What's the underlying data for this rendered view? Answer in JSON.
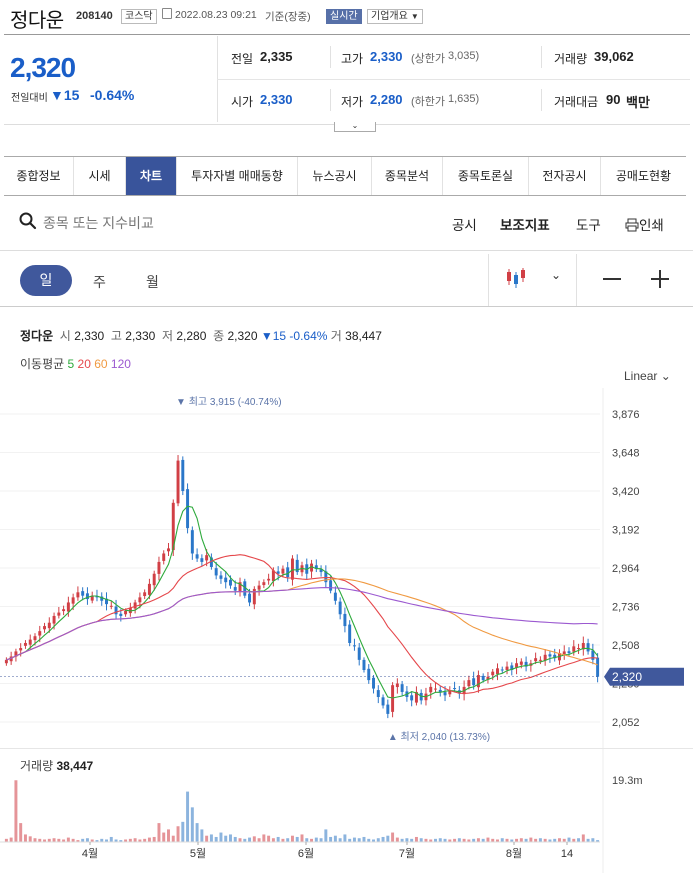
{
  "header": {
    "stock_name": "정다운",
    "stock_code": "208140",
    "market_badge": "코스닥",
    "timestamp": "2022.08.23 09:21",
    "timestamp_basis": "기준(장중)",
    "realtime_badge": "실시간",
    "company_info_label": "기업개요"
  },
  "quote": {
    "price": "2,320",
    "change_label": "전일대비",
    "change_value": "15",
    "change_pct": "-0.64%",
    "prev_close_label": "전일",
    "prev_close": "2,335",
    "open_label": "시가",
    "open": "2,330",
    "high_label": "고가",
    "high": "2,330",
    "upper_limit_label": "(상한가",
    "upper_limit": "3,035)",
    "low_label": "저가",
    "low": "2,280",
    "lower_limit_label": "(하한가",
    "lower_limit": "1,635)",
    "volume_label": "거래량",
    "volume": "39,062",
    "amount_label": "거래대금",
    "amount": "90",
    "amount_unit": "백만"
  },
  "tabs": [
    {
      "label": "종합정보"
    },
    {
      "label": "시세"
    },
    {
      "label": "차트"
    },
    {
      "label": "투자자별 매매동향"
    },
    {
      "label": "뉴스공시"
    },
    {
      "label": "종목분석"
    },
    {
      "label": "종목토론실"
    },
    {
      "label": "전자공시"
    },
    {
      "label": "공매도현황"
    }
  ],
  "toolbar": {
    "search_placeholder": "종목 또는 지수비교",
    "disclosure": "공시",
    "indicators": "보조지표",
    "tools": "도구",
    "print": "인쇄"
  },
  "periods": {
    "day": "일",
    "week": "주",
    "month": "월"
  },
  "chart_info": {
    "name": "정다운",
    "open_label": "시",
    "open": "2,330",
    "high_label": "고",
    "high": "2,330",
    "low_label": "저",
    "low": "2,280",
    "close_label": "종",
    "close": "2,320",
    "change": "▼15 -0.64%",
    "vol_label": "거",
    "vol": "38,447",
    "ma_label": "이동평균",
    "ma": [
      {
        "period": "5",
        "color": "#2eaa3c"
      },
      {
        "period": "20",
        "color": "#e5474b"
      },
      {
        "period": "60",
        "color": "#f09a42"
      },
      {
        "period": "120",
        "color": "#9b59d0"
      }
    ],
    "scale_mode": "Linear"
  },
  "chart_data": {
    "type": "candlestick",
    "y_ticks": [
      "3,876",
      "3,648",
      "3,420",
      "3,192",
      "2,964",
      "2,736",
      "2,508",
      "2,280",
      "2,052"
    ],
    "y_range": [
      2052,
      3876
    ],
    "current_price_label": "2,320",
    "current_price": 2320,
    "max_label": "최고 3,915 (-40.74%)",
    "min_label": "최저 2,040 (13.73%)",
    "x_labels": [
      "4월",
      "5월",
      "6월",
      "7월",
      "8월",
      "14"
    ],
    "volume_title": "거래량",
    "volume_value": "38,447",
    "volume_tick": "19.3m",
    "up_color": "#d13f45",
    "down_color": "#2a77c9",
    "closes": [
      2420,
      2440,
      2470,
      2490,
      2520,
      2540,
      2560,
      2590,
      2620,
      2640,
      2680,
      2700,
      2720,
      2760,
      2790,
      2820,
      2800,
      2780,
      2800,
      2790,
      2770,
      2750,
      2740,
      2690,
      2680,
      2710,
      2730,
      2760,
      2790,
      2820,
      2870,
      2930,
      3000,
      3050,
      3080,
      3350,
      3600,
      3420,
      3200,
      3050,
      3020,
      3000,
      3040,
      2970,
      2920,
      2900,
      2880,
      2860,
      2830,
      2880,
      2800,
      2760,
      2840,
      2860,
      2880,
      2900,
      2950,
      2930,
      2960,
      2910,
      3020,
      2940,
      2980,
      2930,
      2990,
      2960,
      2940,
      2880,
      2830,
      2770,
      2690,
      2620,
      2520,
      2500,
      2420,
      2360,
      2300,
      2250,
      2200,
      2150,
      2100,
      2270,
      2280,
      2230,
      2200,
      2180,
      2230,
      2180,
      2220,
      2260,
      2250,
      2230,
      2210,
      2240,
      2250,
      2220,
      2260,
      2300,
      2270,
      2330,
      2300,
      2320,
      2350,
      2370,
      2360,
      2380,
      2360,
      2400,
      2410,
      2380,
      2400,
      2430,
      2420,
      2450,
      2440,
      2430,
      2460,
      2470,
      2460,
      2500,
      2490,
      2520,
      2470,
      2420,
      2320
    ],
    "volumes": [
      0.05,
      0.07,
      0.98,
      0.3,
      0.12,
      0.09,
      0.06,
      0.05,
      0.04,
      0.05,
      0.06,
      0.05,
      0.04,
      0.07,
      0.05,
      0.03,
      0.05,
      0.06,
      0.04,
      0.03,
      0.05,
      0.04,
      0.08,
      0.04,
      0.03,
      0.04,
      0.05,
      0.06,
      0.04,
      0.05,
      0.07,
      0.08,
      0.3,
      0.15,
      0.2,
      0.1,
      0.25,
      0.32,
      0.8,
      0.55,
      0.3,
      0.2,
      0.1,
      0.12,
      0.08,
      0.15,
      0.1,
      0.12,
      0.08,
      0.06,
      0.05,
      0.07,
      0.09,
      0.06,
      0.12,
      0.1,
      0.06,
      0.08,
      0.05,
      0.06,
      0.1,
      0.08,
      0.12,
      0.06,
      0.05,
      0.07,
      0.06,
      0.2,
      0.08,
      0.1,
      0.06,
      0.12,
      0.05,
      0.07,
      0.06,
      0.08,
      0.05,
      0.04,
      0.06,
      0.08,
      0.1,
      0.15,
      0.07,
      0.05,
      0.06,
      0.05,
      0.08,
      0.06,
      0.05,
      0.04,
      0.05,
      0.06,
      0.05,
      0.04,
      0.05,
      0.06,
      0.05,
      0.04,
      0.05,
      0.06,
      0.05,
      0.07,
      0.05,
      0.04,
      0.06,
      0.05,
      0.04,
      0.05,
      0.06,
      0.05,
      0.07,
      0.05,
      0.06,
      0.05,
      0.04,
      0.05,
      0.06,
      0.05,
      0.07,
      0.05,
      0.06,
      0.12,
      0.05,
      0.06,
      0.03
    ]
  }
}
